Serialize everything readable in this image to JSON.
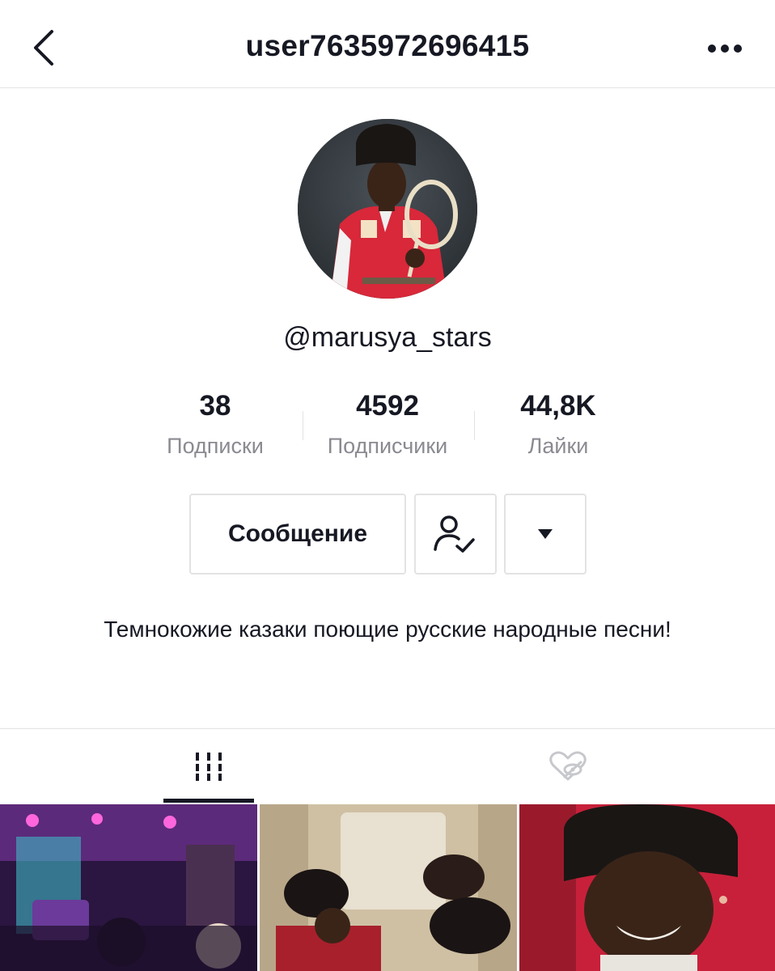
{
  "header": {
    "title": "user7635972696415",
    "back_icon": "chevron-left-icon",
    "more_icon": "more-dots-icon"
  },
  "profile": {
    "username": "@marusya_stars",
    "stats": [
      {
        "value": "38",
        "label": "Подписки"
      },
      {
        "value": "4592",
        "label": "Подписчики"
      },
      {
        "value": "44,8K",
        "label": "Лайки"
      }
    ],
    "message_button": "Сообщение",
    "follow_icon": "person-check-icon",
    "dropdown_icon": "caret-down-icon",
    "bio": "Темнокожие казаки поющие русские народные песни!"
  },
  "tabs": [
    {
      "icon": "video-grid-icon",
      "active": true
    },
    {
      "icon": "liked-hidden-icon",
      "active": false
    }
  ],
  "colors": {
    "text": "#161823",
    "muted": "#8a8b91",
    "border": "#e3e3e4"
  }
}
